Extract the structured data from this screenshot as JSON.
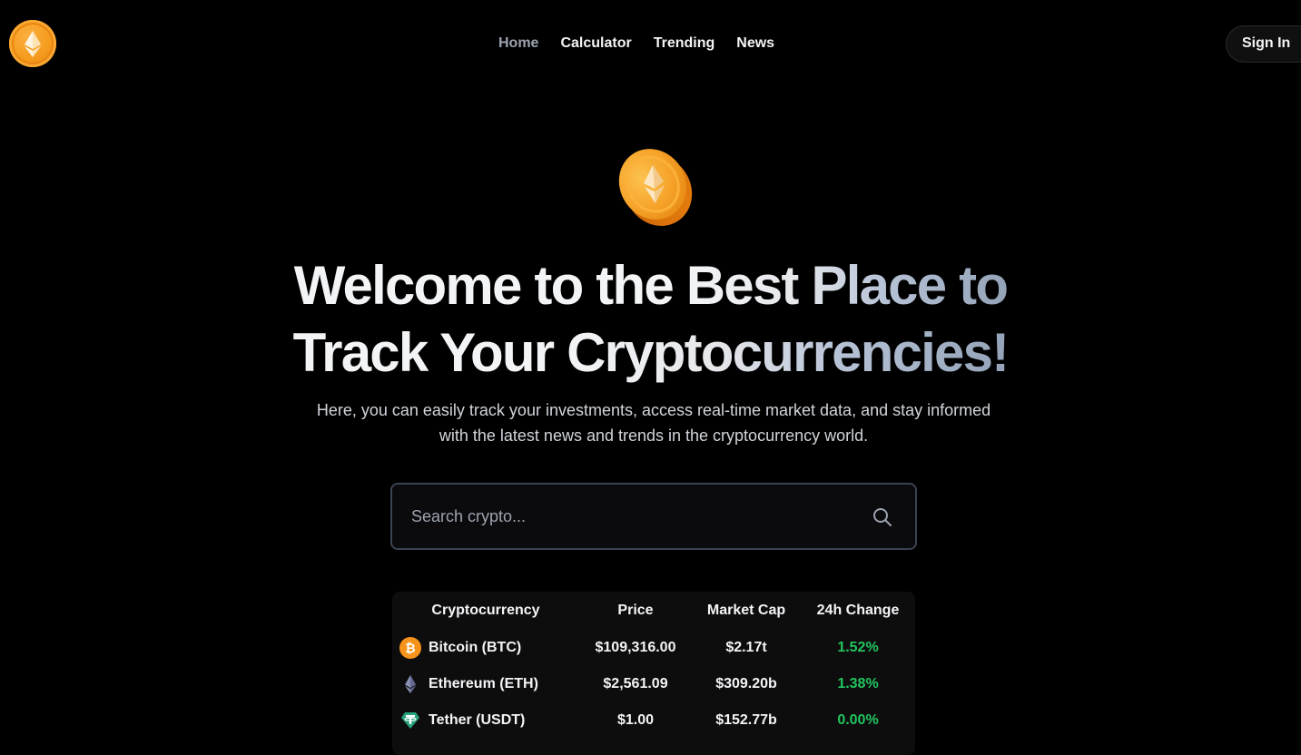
{
  "header": {
    "logo_icon": "ethereum-coin-logo",
    "nav": [
      {
        "label": "Home",
        "active": true
      },
      {
        "label": "Calculator",
        "active": false
      },
      {
        "label": "Trending",
        "active": false
      },
      {
        "label": "News",
        "active": false
      }
    ],
    "signin_label": "Sign In"
  },
  "hero": {
    "coin_icon": "ethereum-gold-coin",
    "headline_line1_plain": "Welcome to the ",
    "headline_line1_gradient": "Best Place to",
    "headline_line2_plain": "Track Your ",
    "headline_line2_gradient": "Cryptocurrencies!",
    "subtitle": "Here, you can easily track your investments, access real-time market data, and stay informed with the latest news and trends in the cryptocurrency world."
  },
  "search": {
    "placeholder": "Search crypto...",
    "value": "",
    "icon": "search-icon"
  },
  "table": {
    "headers": [
      "Cryptocurrency",
      "Price",
      "Market Cap",
      "24h Change"
    ],
    "rows": [
      {
        "icon": "bitcoin-icon",
        "name": "Bitcoin (BTC)",
        "price": "$109,316.00",
        "market_cap": "$2.17t",
        "change": "1.52%"
      },
      {
        "icon": "ethereum-icon",
        "name": "Ethereum (ETH)",
        "price": "$2,561.09",
        "market_cap": "$309.20b",
        "change": "1.38%"
      },
      {
        "icon": "tether-icon",
        "name": "Tether (USDT)",
        "price": "$1.00",
        "market_cap": "$152.77b",
        "change": "0.00%"
      }
    ]
  },
  "colors": {
    "background": "#000000",
    "accent_orange": "#f7931a",
    "positive_green": "#22c55e",
    "muted_gray": "#9ca3af"
  }
}
